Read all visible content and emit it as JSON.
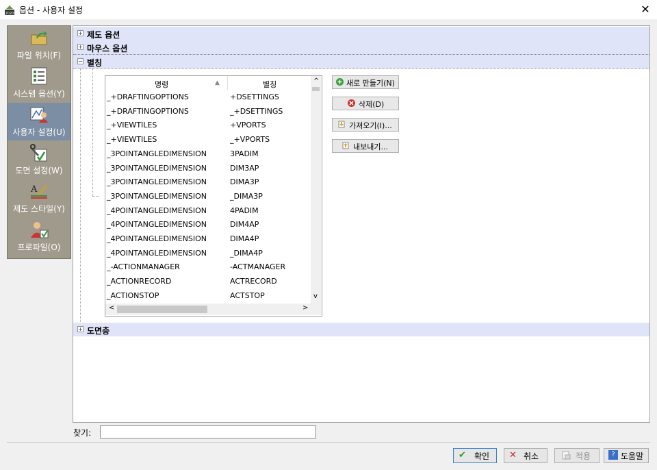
{
  "window": {
    "title": "옵션 - 사용자 설정",
    "close_glyph": "✕",
    "app_icon_label": "2020"
  },
  "nav": {
    "items": [
      {
        "label": "파일 위치(F)",
        "icon": "folder-arrow-icon"
      },
      {
        "label": "시스템 옵션(Y)",
        "icon": "checklist-icon"
      },
      {
        "label": "사용자 설정(U)",
        "icon": "user-settings-icon",
        "selected": true
      },
      {
        "label": "도면 설정(W)",
        "icon": "drawing-settings-icon"
      },
      {
        "label": "제도 스타일(Y)",
        "icon": "drafting-style-icon"
      },
      {
        "label": "프로파일(O)",
        "icon": "profile-icon"
      }
    ]
  },
  "groups": {
    "drafting": {
      "label": "제도 옵션",
      "expander": "+"
    },
    "mouse": {
      "label": "마우스 옵션",
      "expander": "+"
    },
    "alias": {
      "label": "별칭",
      "expander": "−"
    },
    "layers": {
      "label": "도면층",
      "expander": "+"
    }
  },
  "alias_table": {
    "columns": [
      "명령",
      "별칭"
    ],
    "sort_glyph": "▲",
    "rows": [
      [
        "_+DRAFTINGOPTIONS",
        "+DSETTINGS"
      ],
      [
        "_+DRAFTINGOPTIONS",
        "_+DSETTINGS"
      ],
      [
        "_+VIEWTILES",
        "+VPORTS"
      ],
      [
        "_+VIEWTILES",
        "_+VPORTS"
      ],
      [
        "_3POINTANGLEDIMENSION",
        "3PADIM"
      ],
      [
        "_3POINTANGLEDIMENSION",
        "DIM3AP"
      ],
      [
        "_3POINTANGLEDIMENSION",
        "DIMA3P"
      ],
      [
        "_3POINTANGLEDIMENSION",
        "_DIMA3P"
      ],
      [
        "_4POINTANGLEDIMENSION",
        "4PADIM"
      ],
      [
        "_4POINTANGLEDIMENSION",
        "DIM4AP"
      ],
      [
        "_4POINTANGLEDIMENSION",
        "DIMA4P"
      ],
      [
        "_4POINTANGLEDIMENSION",
        "_DIMA4P"
      ],
      [
        "_-ACTIONMANAGER",
        "-ACTMANAGER"
      ],
      [
        "_ACTIONRECORD",
        "ACTRECORD"
      ],
      [
        "_ACTIONSTOP",
        "ACTSTOP"
      ]
    ],
    "scroll": {
      "up": "^",
      "down": "v",
      "left": "<",
      "right": ">"
    }
  },
  "actions": {
    "new": "새로 만들기(N)",
    "delete": "삭제(D)",
    "import": "가져오기(I)...",
    "export": "내보내기..."
  },
  "search": {
    "label": "찾기:",
    "value": ""
  },
  "buttons": {
    "ok": "확인",
    "cancel": "취소",
    "apply": "적용",
    "help": "도움말"
  },
  "colors": {
    "group_bg": "#e0e4f8",
    "nav_bg": "#a09a8c",
    "nav_selected": "#7b8ea4"
  }
}
